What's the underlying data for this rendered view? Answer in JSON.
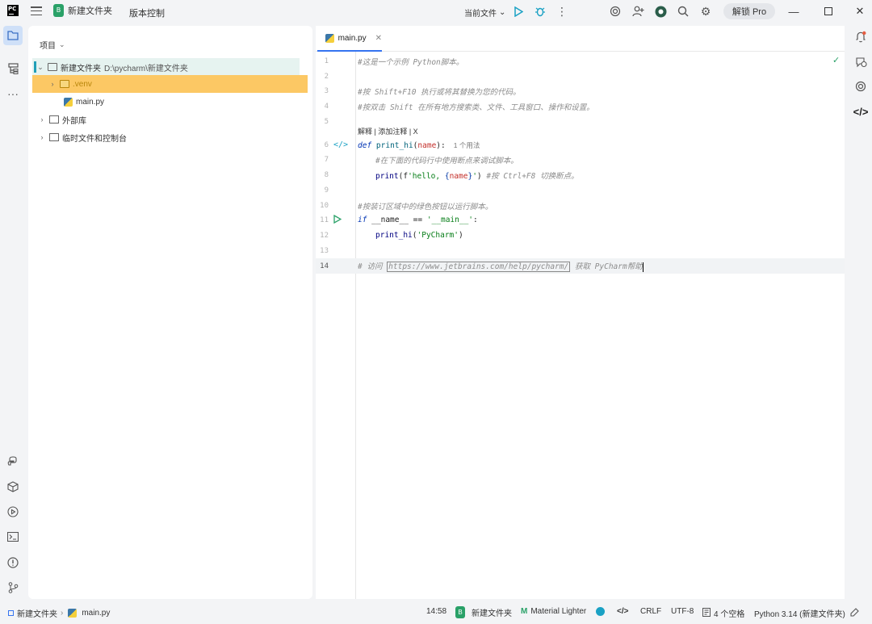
{
  "titlebar": {
    "logo_text": "PC",
    "project_badge": "B",
    "project_name": "新建文件夹",
    "vcs": "版本控制",
    "run_config": "当前文件",
    "unlock_pro": "解锁 Pro"
  },
  "project_panel": {
    "header": "项目",
    "tree": {
      "root_name": "新建文件夹",
      "root_path": "D:\\pycharm\\新建文件夹",
      "venv": ".venv",
      "main_file": "main.py",
      "external_libs": "外部库",
      "scratches": "临时文件和控制台"
    }
  },
  "editor": {
    "tab_label": "main.py",
    "line_numbers": [
      "1",
      "2",
      "3",
      "4",
      "5",
      "6",
      "7",
      "8",
      "9",
      "10",
      "11",
      "12",
      "13",
      "14"
    ],
    "lines": {
      "l1": "#这是一个示例 Python脚本。",
      "l3": "#按 Shift+F10 执行或将其替换为您的代码。",
      "l4": "#按双击 Shift 在所有地方搜索类、文件、工具窗口、操作和设置。",
      "inlay": "解释 | 添加注释 | X",
      "l6_def": "def",
      "l6_name": "print_hi",
      "l6_paren_open": "(",
      "l6_param": "name",
      "l6_paren_close": "):",
      "l6_usage": "1 个用法",
      "l7": "#在下面的代码行中使用断点来调试脚本。",
      "l8_call": "print",
      "l8_open": "(f",
      "l8_str_a": "'hello, ",
      "l8_brace_open": "{",
      "l8_var": "name",
      "l8_brace_close": "}",
      "l8_str_b": "'",
      "l8_close": ")",
      "l8_comment": " #按 Ctrl+F8 切换断点。",
      "l10": "#按装订区域中的绿色按钮以运行脚本。",
      "l11_if": "if",
      "l11_a": " __name__ == ",
      "l11_str": "'__main__'",
      "l11_b": ":",
      "l12_call": "print_hi",
      "l12_open": "(",
      "l12_str": "'PyCharm'",
      "l12_close": ")",
      "l14_a": "# 访问 ",
      "l14_url": "https://www.jetbrains.com/help/pycharm/",
      "l14_b": " 获取 PyCharm帮助"
    }
  },
  "statusbar": {
    "breadcrumb_folder": "新建文件夹",
    "breadcrumb_file": "main.py",
    "time": "14:58",
    "project_badge": "B",
    "project": "新建文件夹",
    "theme": "Material Lighter",
    "line_sep": "CRLF",
    "encoding": "UTF-8",
    "indent": "4 个空格",
    "interpreter": "Python 3.14 (新建文件夹)"
  },
  "colors": {
    "accent": "#3574f0",
    "selection": "#fcc864",
    "project_badge": "#2aa168",
    "run_green": "#2aa168"
  }
}
